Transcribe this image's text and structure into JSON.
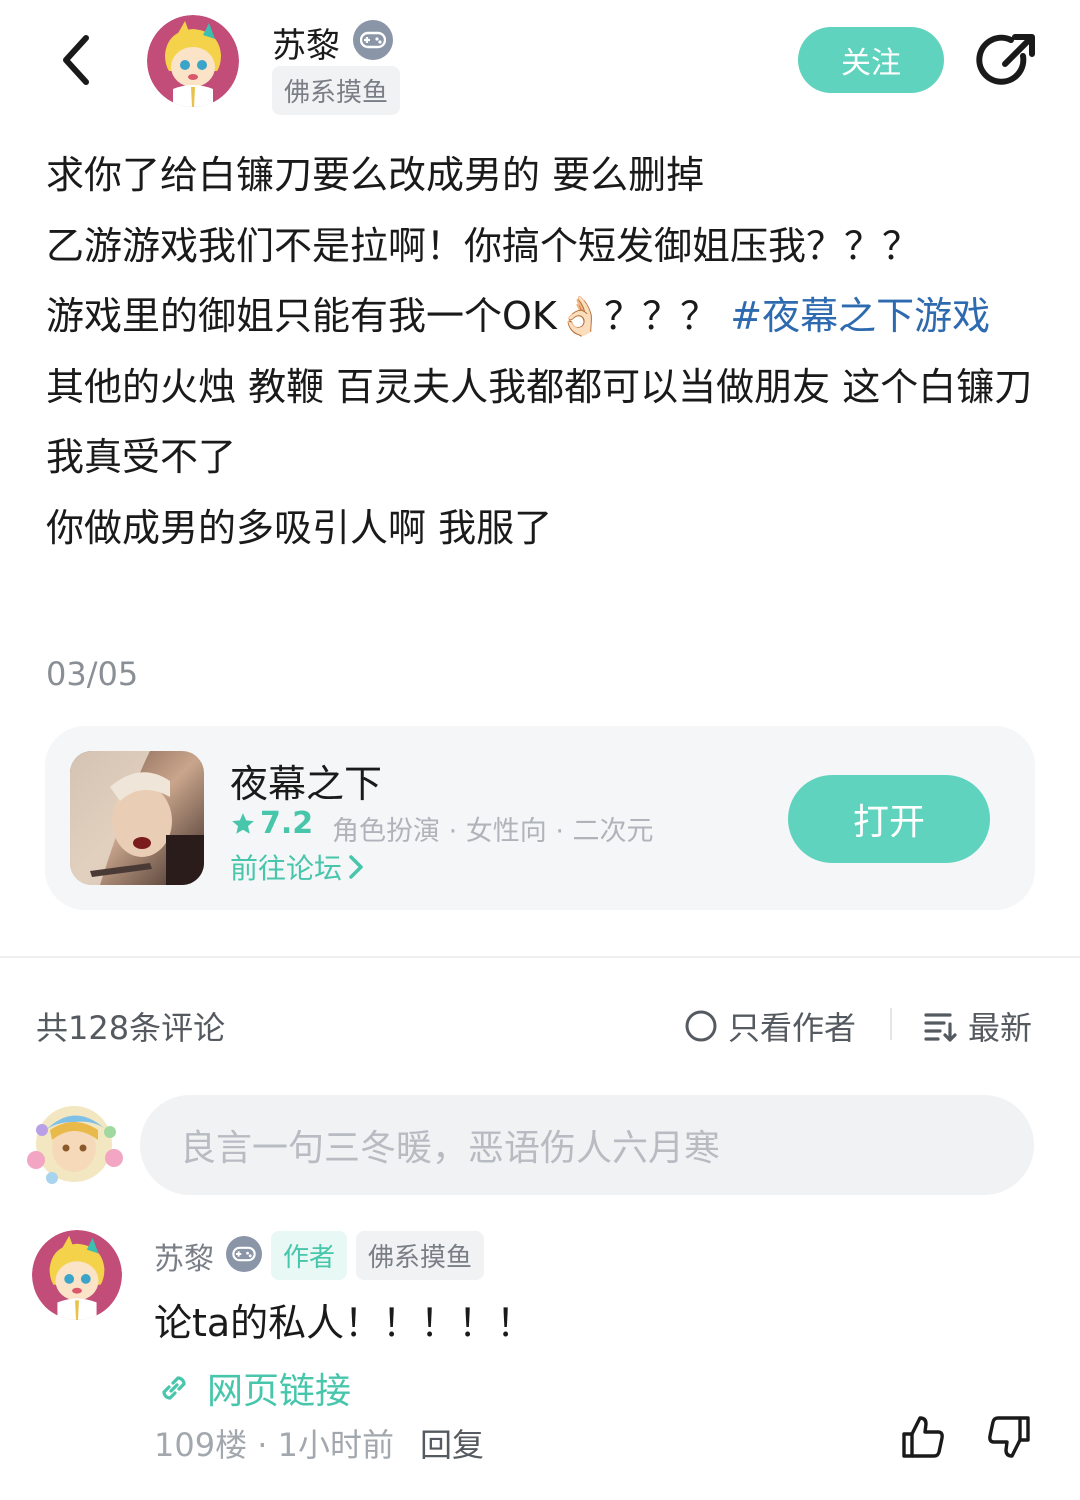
{
  "header": {
    "author_name": "苏黎",
    "author_tag": "佛系摸鱼",
    "follow_label": "关注"
  },
  "post": {
    "lines": [
      "求你了给白镰刀要么改成男的 要么删掉",
      "乙游游戏我们不是拉啊！你搞个短发御姐压我？？？"
    ],
    "line3_text": "游戏里的御姐只能有我一个OK",
    "line3_emoji": "👌🏻",
    "line3_after": "？？？",
    "hashtag": "#夜幕之下游戏",
    "lines_after": [
      "其他的火烛 教鞭 百灵夫人我都都可以当做朋友 这个白镰刀我真受不了",
      "你做成男的多吸引人啊 我服了"
    ],
    "date": "03/05"
  },
  "game_card": {
    "name": "夜幕之下",
    "rating": "7.2",
    "tags": "角色扮演 · 女性向 · 二次元",
    "forum_link": "前往论坛",
    "open_label": "打开"
  },
  "comments_bar": {
    "count_label": "共128条评论",
    "only_author_label": "只看作者",
    "sort_label": "最新"
  },
  "comment_input": {
    "placeholder": "良言一句三冬暖，恶语伤人六月寒"
  },
  "comment": {
    "name": "苏黎",
    "author_badge": "作者",
    "tag": "佛系摸鱼",
    "text": "论ta的私人！！！！！",
    "link_label": "网页链接",
    "meta": "109楼 · 1小时前",
    "reply_label": "回复"
  },
  "colors": {
    "accent": "#5fd3bd",
    "hashtag": "#2e6ab0",
    "muted": "#8a8f96"
  }
}
